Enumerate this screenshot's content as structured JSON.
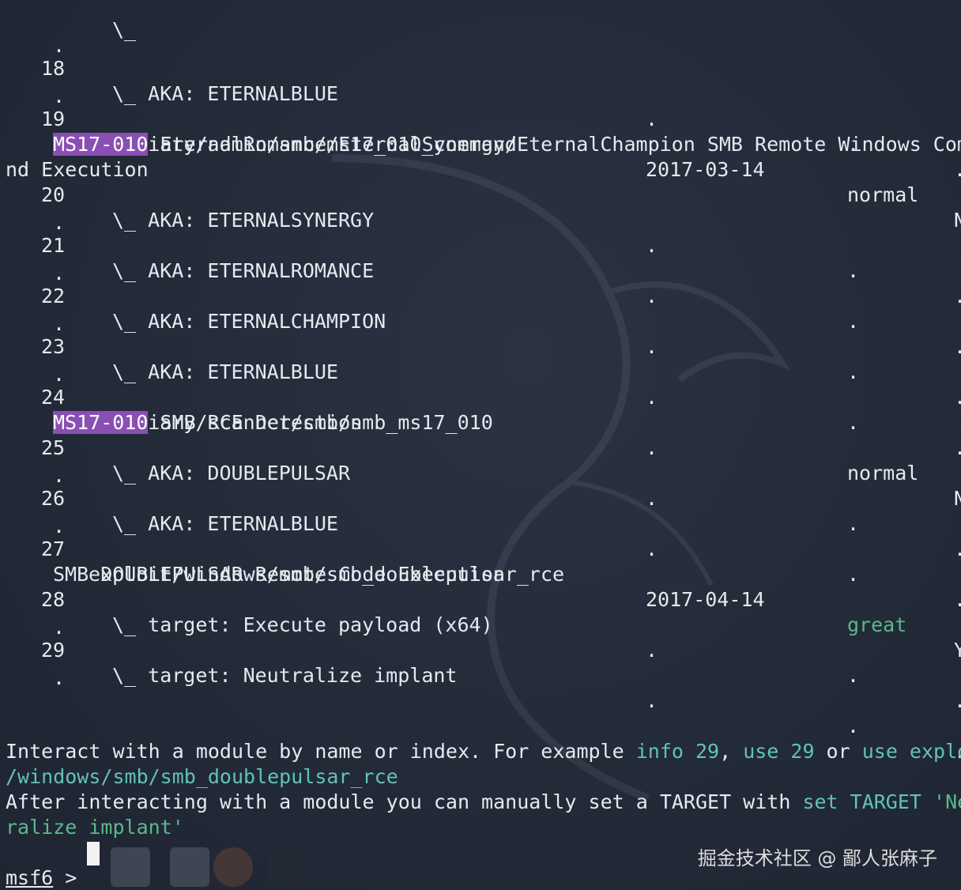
{
  "rows": [
    {
      "idx": "18",
      "name": "\\_ AKA: ETERNALBLUE",
      "date": ".",
      "rank": ".",
      "check": "."
    },
    {
      "idx": "19",
      "name": "auxiliary/admin/smb/ms17_010_command",
      "date": "2017-03-14",
      "rank": "normal",
      "check": "N",
      "desc_hl": "MS17-010",
      "desc": " EternalRomance/EternalSynergy/EternalChampion SMB Remote Windows Com",
      "desc_cont": "nd Execution"
    },
    {
      "idx": "20",
      "name": "\\_ AKA: ETERNALSYNERGY",
      "date": ".",
      "rank": ".",
      "check": "."
    },
    {
      "idx": "21",
      "name": "\\_ AKA: ETERNALROMANCE",
      "date": ".",
      "rank": ".",
      "check": "."
    },
    {
      "idx": "22",
      "name": "\\_ AKA: ETERNALCHAMPION",
      "date": ".",
      "rank": ".",
      "check": "."
    },
    {
      "idx": "23",
      "name": "\\_ AKA: ETERNALBLUE",
      "date": ".",
      "rank": ".",
      "check": "."
    },
    {
      "idx": "24",
      "name": "auxiliary/scanner/smb/smb_ms17_010",
      "date": ".",
      "rank": "normal",
      "check": "N",
      "desc_hl": "MS17-010",
      "desc": " SMB RCE Detection"
    },
    {
      "idx": "25",
      "name": "\\_ AKA: DOUBLEPULSAR",
      "date": ".",
      "rank": ".",
      "check": "."
    },
    {
      "idx": "26",
      "name": "\\_ AKA: ETERNALBLUE",
      "date": ".",
      "rank": ".",
      "check": "."
    },
    {
      "idx": "27",
      "name": "exploit/windows/smb/smb_doublepulsar_rce",
      "date": "2017-04-14",
      "rank": "great",
      "check": "Y",
      "desc": "SMB DOUBLEPULSAR Remote Code Execution"
    },
    {
      "idx": "28",
      "name": "\\_ target: Execute payload (x64)",
      "date": ".",
      "rank": ".",
      "check": "."
    },
    {
      "idx": "29",
      "name": "\\_ target: Neutralize implant",
      "date": ".",
      "rank": ".",
      "check": "."
    }
  ],
  "wrap_dot": ".",
  "help": {
    "line1_a": "Interact with a module by name or index. For example ",
    "line1_info": "info 29",
    "line1_b": ", ",
    "line1_use": "use 29",
    "line1_c": " or ",
    "line1_use2": "use explo",
    "line2": "/windows/smb/smb_doublepulsar_rce",
    "line3_a": "After interacting with a module you can manually set a TARGET with ",
    "line3_set": "set TARGET ",
    "line3_q": "'Ne",
    "line4": "ralize implant'"
  },
  "prompt": {
    "name": "msf6",
    "symbol": " >"
  },
  "watermark": "掘金技术社区 @ 鄙人张麻子",
  "colors": {
    "background": "#232a38",
    "highlight": "#8a4fb3",
    "command": "#61c4b0",
    "great": "#5cb88a"
  }
}
